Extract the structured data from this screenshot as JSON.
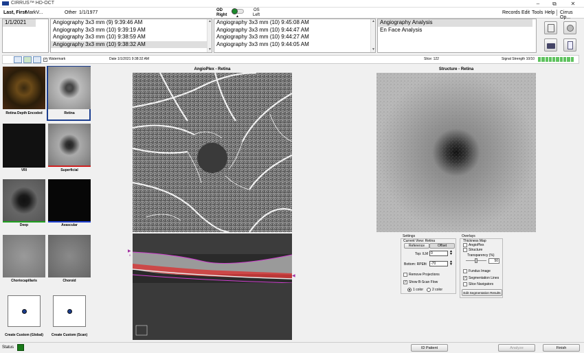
{
  "window": {
    "title": "CIRRUS™ HD-OCT",
    "minimize": "–",
    "maximize": "⧉",
    "close": "✕"
  },
  "patient": {
    "name": "Last, First",
    "doctor": "MarkV...",
    "gender": "Other",
    "dob": "1/1/1977"
  },
  "eye": {
    "od": "OD",
    "od_label": "Right",
    "os": "OS",
    "os_label": "Left"
  },
  "menu": [
    "Records",
    "Edit",
    "Tools",
    "Help",
    "Cirrus Op..."
  ],
  "dates": [
    "1/1/2021"
  ],
  "scans_left": [
    "Angiography 3x3 mm (9)  9:39:46 AM",
    "Angiography 3x3 mm (10)  9:39:19 AM",
    "Angiography 3x3 mm (10)  9:38:59 AM",
    "Angiography 3x3 mm (10)  9:38:32 AM"
  ],
  "scans_right": [
    "Angiography 3x3 mm (10)  9:45:08 AM",
    "Angiography 3x3 mm (10)  9:44:47 AM",
    "Angiography 3x3 mm (10)  9:44:27 AM",
    "Angiography 3x3 mm (10)  9:44:05 AM"
  ],
  "analysis": [
    "Angiography Analysis",
    "En Face Analysis"
  ],
  "infobar": {
    "watermark": "Watermark",
    "date": "Date 1/1/2021 9:38:32 AM",
    "slice": "Slice: 122",
    "signal": "Signal Strength 10/10",
    "signal_value": 10,
    "signal_max": 10
  },
  "thumbs": [
    {
      "label": "Retina Depth Encoded",
      "bar": ""
    },
    {
      "label": "Retina",
      "bar": ""
    },
    {
      "label": "VRI",
      "bar": ""
    },
    {
      "label": "Superficial",
      "bar": "#d02020"
    },
    {
      "label": "Deep",
      "bar": "#20a020"
    },
    {
      "label": "Avascular",
      "bar": "#2040d0"
    },
    {
      "label": "Choriocapillaris",
      "bar": ""
    },
    {
      "label": "Choroid",
      "bar": ""
    },
    {
      "label": "Create Custom (Global)",
      "bar": ""
    },
    {
      "label": "Create Custom (Scan)",
      "bar": ""
    }
  ],
  "views": {
    "main_title": "AngioPlex - Retina",
    "struct_title": "Structure - Retina",
    "bscan_mark": "0"
  },
  "settings": {
    "title": "Settings",
    "current_view": "Current View: Retina",
    "tab_reference": "Reference",
    "tab_offset": "Offset",
    "top_label": "Top:  ILM",
    "top_value": "0",
    "bottom_label": "Bottom:  RPEfit",
    "bottom_value": "-70",
    "remove_projections": "Remove Projections",
    "show_flow": "Show B-Scan Flow",
    "one_color": "1 color",
    "two_color": "2 color"
  },
  "overlays": {
    "title": "Overlays",
    "thickness_map": "Thickness Map",
    "angioplex": "AngioPlex",
    "structure": "Structure",
    "transparency": "Transparency (%)",
    "transparency_value": "50",
    "fundus": "Fundus Image",
    "seg_lines": "Segmentation Lines",
    "slice_nav": "Slice Navigators",
    "edit_btn": "Edit Segmentation Results"
  },
  "status": {
    "label": "Status",
    "id_patient": "ID Patient",
    "analyze": "Analyze",
    "finish": "Finish"
  },
  "colors": {
    "accent": "#1a3d8f",
    "status": "#1a7a1a",
    "signal": "#5fc35f",
    "ilm_line": "#d040d0"
  }
}
